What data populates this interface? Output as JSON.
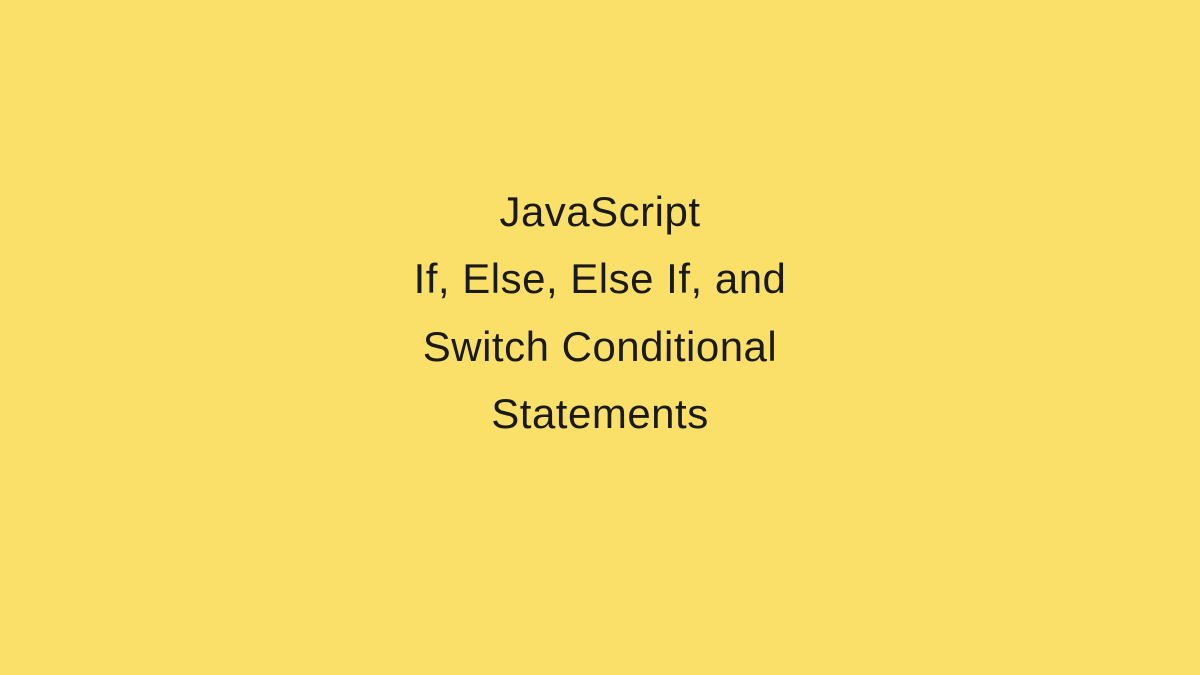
{
  "slide": {
    "background_color": "#fae069",
    "title_lines": {
      "line1": "JavaScript",
      "line2": "If, Else, Else If, and",
      "line3": "Switch Conditional",
      "line4": "Statements"
    }
  }
}
